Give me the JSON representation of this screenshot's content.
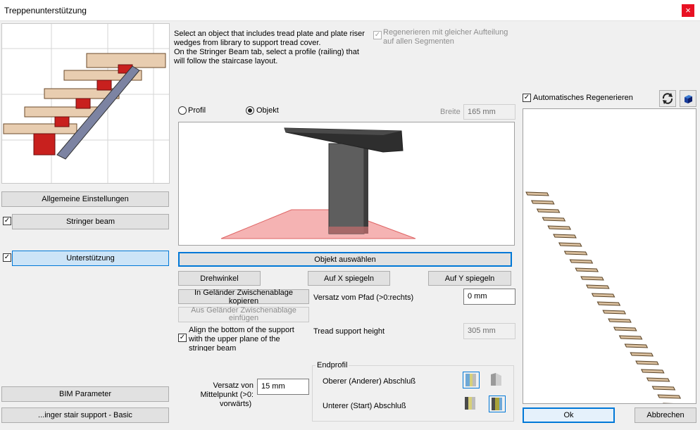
{
  "window": {
    "title": "Treppenunterstützung",
    "close_glyph": "×"
  },
  "info_text": {
    "line1": "Select an object that includes tread plate and plate riser",
    "line2": "wedges from library to support tread cover.",
    "line3": "On the Stringer Beam tab, select a profile (railing) that",
    "line4": "will follow the staircase layout."
  },
  "regen_same": {
    "line1": "Regenerieren mit gleicher Aufteilung",
    "line2": "auf allen Segmenten",
    "checked": true
  },
  "auto_regen": {
    "label": "Automatisches Regenerieren",
    "checked": true
  },
  "sidebar": {
    "general": "Allgemeine Einstellungen",
    "stringer": "Stringer beam",
    "support": "Unterstützung",
    "bim": "BIM Parameter",
    "preset": "...inger stair support - Basic"
  },
  "mode": {
    "profil": "Profil",
    "objekt": "Objekt",
    "selected": "objekt"
  },
  "width": {
    "label": "Breite",
    "value": "165 mm"
  },
  "buttons": {
    "select_object": "Objekt auswählen",
    "rotation": "Drehwinkel",
    "mirror_x": "Auf X spiegeln",
    "mirror_y": "Auf Y spiegeln",
    "copy_clip": "In Geländer Zwischenablage kopieren",
    "paste_clip_l1": "Aus Geländer Zwischenablage",
    "paste_clip_l2": "einfügen",
    "ok": "Ok",
    "cancel": "Abbrechen"
  },
  "path_offset": {
    "label": "Versatz vom Pfad (>0:rechts)",
    "value": "0 mm"
  },
  "tread_height": {
    "label": "Tread support height",
    "value": "305 mm"
  },
  "align_bottom": {
    "line1": "Align the bottom of the support",
    "line2": "with the upper plane of the",
    "line3": "stringer beam",
    "checked": true
  },
  "mid_offset": {
    "line1": "Versatz von",
    "line2": "Mittelpunkt (>0:",
    "line3": "vorwärts)",
    "value": "15 mm"
  },
  "endprofil": {
    "title": "Endprofil",
    "upper": "Oberer (Anderer) Abschluß",
    "lower": "Unterer (Start) Abschluß"
  },
  "colors": {
    "accent": "#0078d7",
    "support_red": "#c8201e",
    "tread_wood": "#e8cdb0"
  }
}
